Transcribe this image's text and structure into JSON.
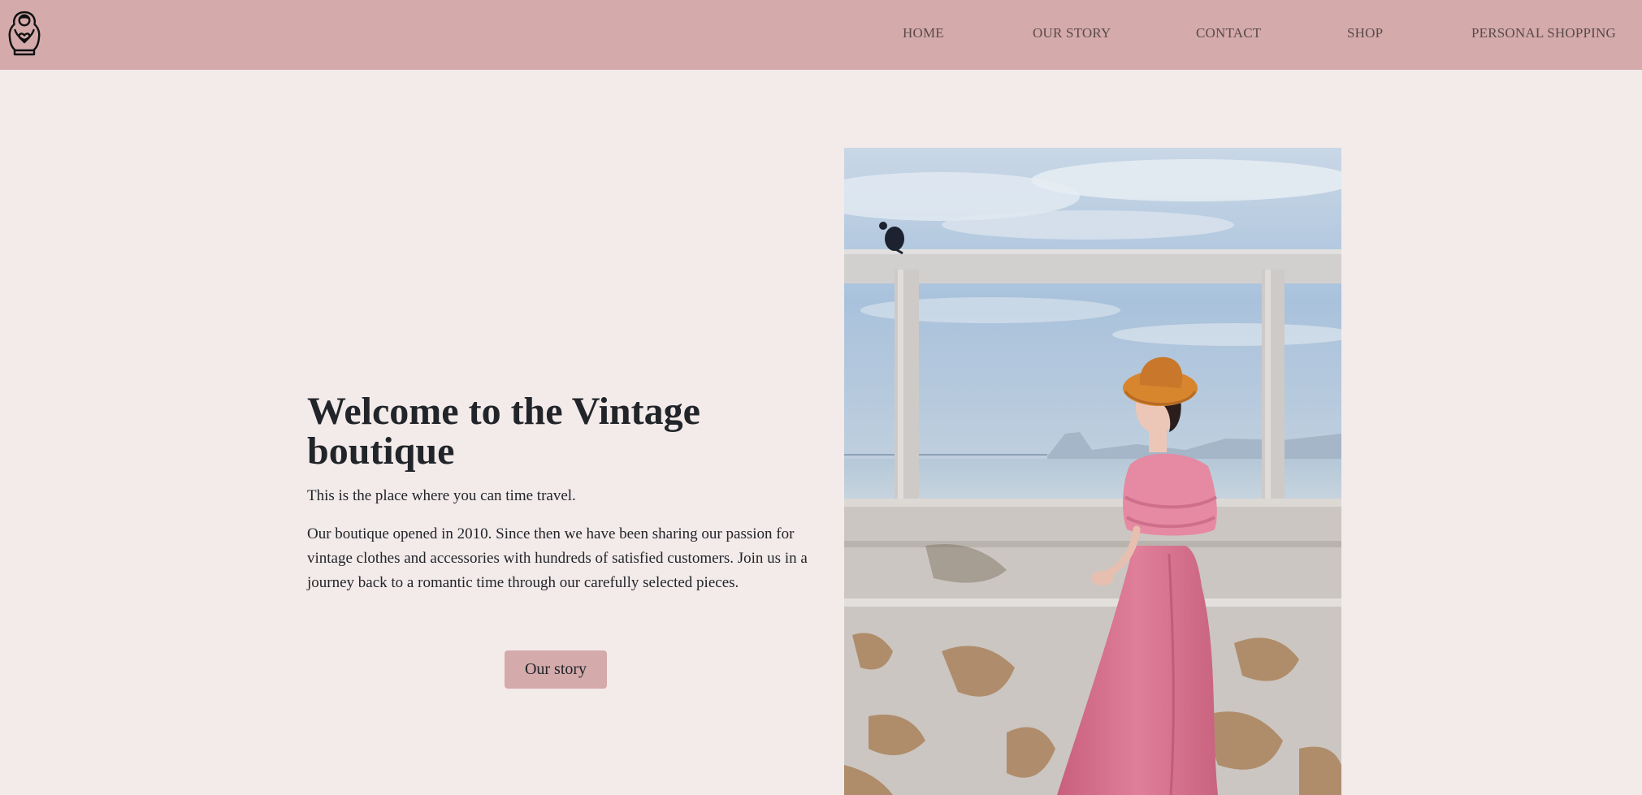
{
  "nav": {
    "logo_icon": "matryoshka-doll-icon",
    "items": [
      {
        "label": "HOME"
      },
      {
        "label": "OUR STORY"
      },
      {
        "label": "CONTACT"
      },
      {
        "label": "SHOP"
      },
      {
        "label": "PERSONAL SHOPPING"
      }
    ]
  },
  "hero": {
    "title": "Welcome to the Vintage boutique",
    "subtitle": "This is the place where you can time travel.",
    "body": "Our boutique opened in 2010. Since then we have been sharing our passion for vintage clothes and accessories with hundreds of satisfied customers. Join us in a journey back to a romantic time through our carefully selected pieces.",
    "button_label": "Our story"
  },
  "colors": {
    "navbar": "#d4aaab",
    "page_background": "#f3eaea",
    "button": "#d4aaab",
    "text": "#212529"
  }
}
